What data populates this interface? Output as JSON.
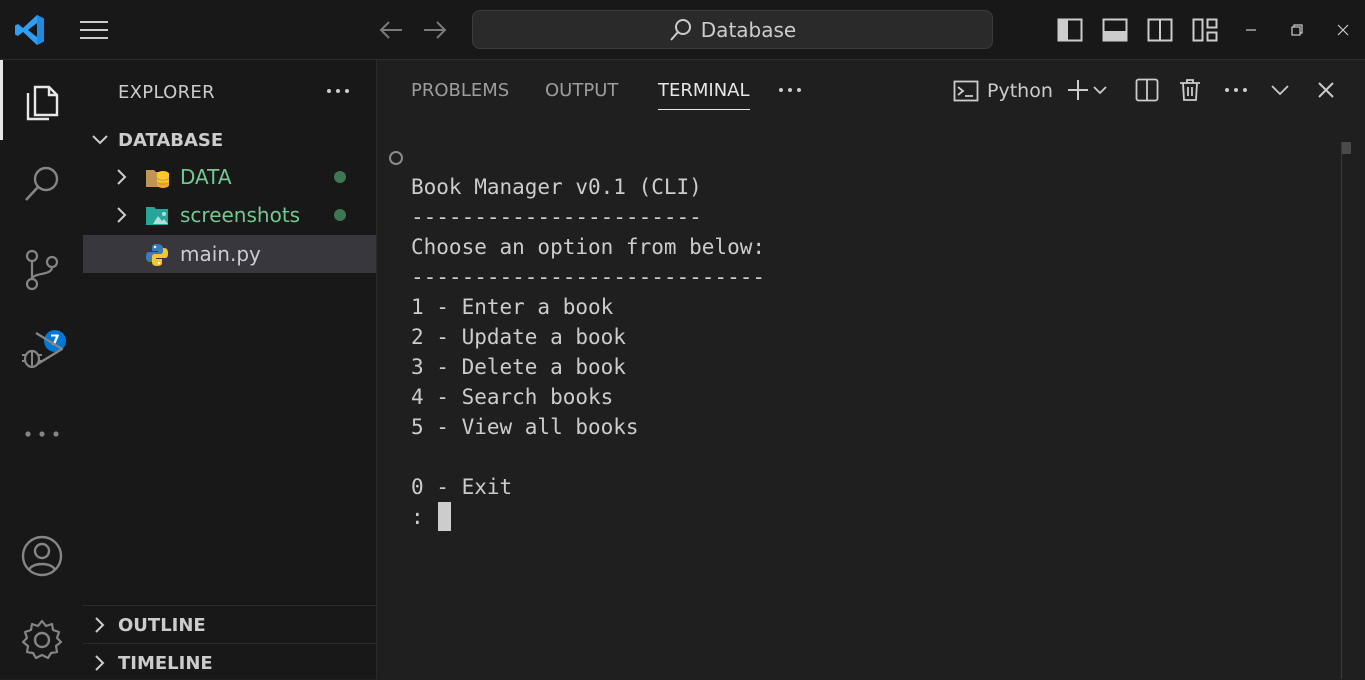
{
  "titlebar": {
    "search_text": "Database",
    "icons": [
      "vscode-logo-icon",
      "hamburger-menu-icon",
      "arrow-left-icon",
      "arrow-right-icon",
      "search-icon",
      "toggle-sidebar-icon",
      "toggle-panel-icon",
      "toggle-secondary-sidebar-icon",
      "customize-layout-icon",
      "minimize-icon",
      "restore-icon",
      "close-icon"
    ]
  },
  "activity_bar": {
    "items": [
      "explorer",
      "search",
      "source-control",
      "run-and-debug",
      "more",
      "accounts",
      "manage"
    ],
    "scm_badge": "7"
  },
  "sidebar": {
    "title": "EXPLORER",
    "root": "DATABASE",
    "items": [
      {
        "label": "DATA",
        "type": "folder",
        "status": "modified"
      },
      {
        "label": "screenshots",
        "type": "folder",
        "status": "modified"
      },
      {
        "label": "main.py",
        "type": "file",
        "selected": true
      }
    ],
    "outline_label": "OUTLINE",
    "timeline_label": "TIMELINE"
  },
  "panel": {
    "tabs": [
      "PROBLEMS",
      "OUTPUT",
      "TERMINAL"
    ],
    "active_tab": "TERMINAL",
    "terminal_profile": "Python"
  },
  "terminal": {
    "lines": [
      "Book Manager v0.1 (CLI)",
      "-----------------------",
      "Choose an option from below:",
      "----------------------------",
      "1 - Enter a book",
      "2 - Update a book",
      "3 - Delete a book",
      "4 - Search books",
      "5 - View all books",
      "",
      "0 - Exit"
    ],
    "prompt": ":"
  },
  "colors": {
    "accent": "#0078d4",
    "git_added": "#73c991",
    "background": "#1f1f1f",
    "sidebar_bg": "#181818"
  }
}
